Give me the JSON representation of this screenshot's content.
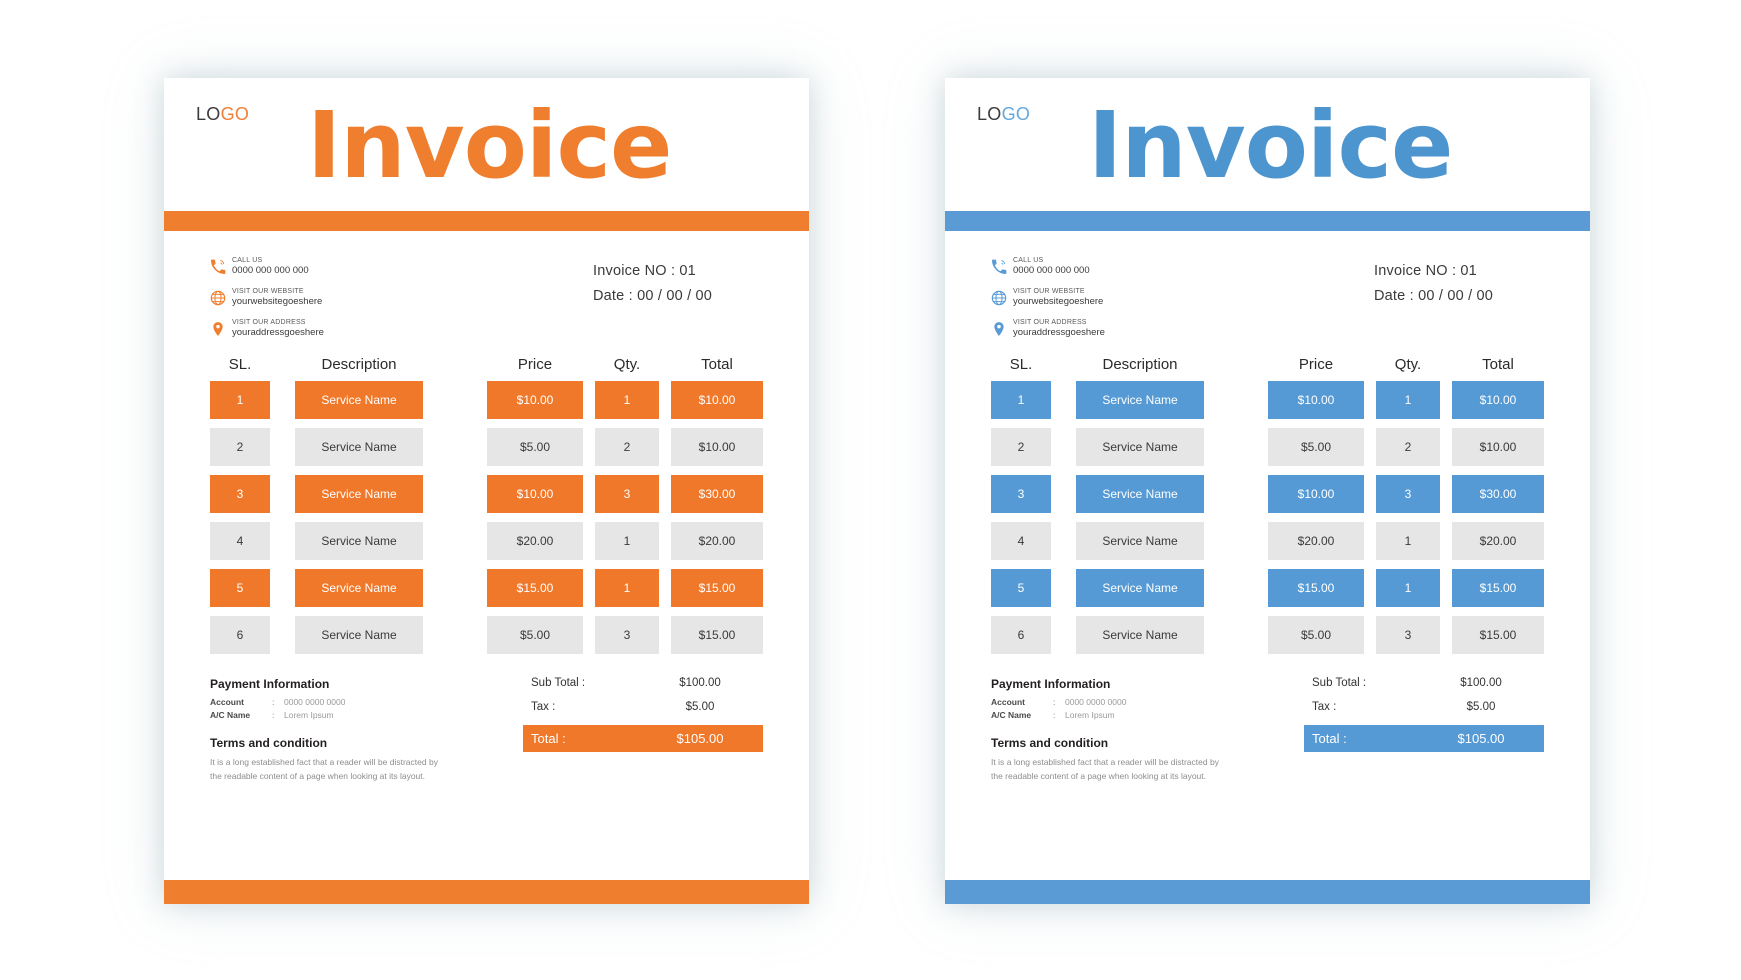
{
  "variants": [
    {
      "key": "orange",
      "accent": "#ef7e2e",
      "fill": "#f0782a",
      "logo_lo": "LO",
      "logo_go": "GO",
      "title": "Invoice",
      "contacts": [
        {
          "icon": "phone-icon",
          "label": "CALL US",
          "value": "0000 000 000 000"
        },
        {
          "icon": "globe-icon",
          "label": "VISIT OUR WEBSITE",
          "value": "yourwebsitegoeshere"
        },
        {
          "icon": "location-pin-icon",
          "label": "VISIT OUR ADDRESS",
          "value": "youraddressgoeshere"
        }
      ],
      "invoice_no": "Invoice NO : 01",
      "date": "Date : 00 / 00 / 00",
      "table": {
        "headers": [
          "SL.",
          "Description",
          "Price",
          "Qty.",
          "Total"
        ],
        "rows": [
          {
            "style": "fill",
            "cells": [
              "1",
              "Service Name",
              "$10.00",
              "1",
              "$10.00"
            ]
          },
          {
            "style": "grey",
            "cells": [
              "2",
              "Service Name",
              "$5.00",
              "2",
              "$10.00"
            ]
          },
          {
            "style": "fill",
            "cells": [
              "3",
              "Service Name",
              "$10.00",
              "3",
              "$30.00"
            ]
          },
          {
            "style": "grey",
            "cells": [
              "4",
              "Service Name",
              "$20.00",
              "1",
              "$20.00"
            ]
          },
          {
            "style": "fill",
            "cells": [
              "5",
              "Service Name",
              "$15.00",
              "1",
              "$15.00"
            ]
          },
          {
            "style": "grey",
            "cells": [
              "6",
              "Service Name",
              "$5.00",
              "3",
              "$15.00"
            ]
          }
        ]
      },
      "payment": {
        "heading": "Payment Information",
        "account_key": "Account",
        "account_value": "0000 0000 0000",
        "acname_key": "A/C Name",
        "acname_value": "Lorem Ipsum"
      },
      "terms": {
        "heading": "Terms and condition",
        "body": "It is a long established fact that a reader will be distracted by the readable content of a page when looking at its layout."
      },
      "totals": [
        {
          "label": "Sub Total :",
          "value": "$100.00",
          "grand": false
        },
        {
          "label": "Tax :",
          "value": "$5.00",
          "grand": false
        },
        {
          "label": "Total :",
          "value": "$105.00",
          "grand": true
        }
      ]
    },
    {
      "key": "blue",
      "accent": "#5b9bd5",
      "fill": "#559ad4",
      "logo_lo": "LO",
      "logo_go": "GO",
      "title": "Invoice",
      "contacts": [
        {
          "icon": "phone-icon",
          "label": "CALL US",
          "value": "0000 000 000 000"
        },
        {
          "icon": "globe-icon",
          "label": "VISIT OUR WEBSITE",
          "value": "yourwebsitegoeshere"
        },
        {
          "icon": "location-pin-icon",
          "label": "VISIT OUR ADDRESS",
          "value": "youraddressgoeshere"
        }
      ],
      "invoice_no": "Invoice NO : 01",
      "date": "Date : 00 / 00 / 00",
      "table": {
        "headers": [
          "SL.",
          "Description",
          "Price",
          "Qty.",
          "Total"
        ],
        "rows": [
          {
            "style": "fill",
            "cells": [
              "1",
              "Service Name",
              "$10.00",
              "1",
              "$10.00"
            ]
          },
          {
            "style": "grey",
            "cells": [
              "2",
              "Service Name",
              "$5.00",
              "2",
              "$10.00"
            ]
          },
          {
            "style": "fill",
            "cells": [
              "3",
              "Service Name",
              "$10.00",
              "3",
              "$30.00"
            ]
          },
          {
            "style": "grey",
            "cells": [
              "4",
              "Service Name",
              "$20.00",
              "1",
              "$20.00"
            ]
          },
          {
            "style": "fill",
            "cells": [
              "5",
              "Service Name",
              "$15.00",
              "1",
              "$15.00"
            ]
          },
          {
            "style": "grey",
            "cells": [
              "6",
              "Service Name",
              "$5.00",
              "3",
              "$15.00"
            ]
          }
        ]
      },
      "payment": {
        "heading": "Payment Information",
        "account_key": "Account",
        "account_value": "0000 0000 0000",
        "acname_key": "A/C Name",
        "acname_value": "Lorem Ipsum"
      },
      "terms": {
        "heading": "Terms and condition",
        "body": "It is a long established fact that a reader will be distracted by the readable content of a page when looking at its layout."
      },
      "totals": [
        {
          "label": "Sub Total :",
          "value": "$100.00",
          "grand": false
        },
        {
          "label": "Tax :",
          "value": "$5.00",
          "grand": false
        },
        {
          "label": "Total :",
          "value": "$105.00",
          "grand": true
        }
      ]
    }
  ]
}
